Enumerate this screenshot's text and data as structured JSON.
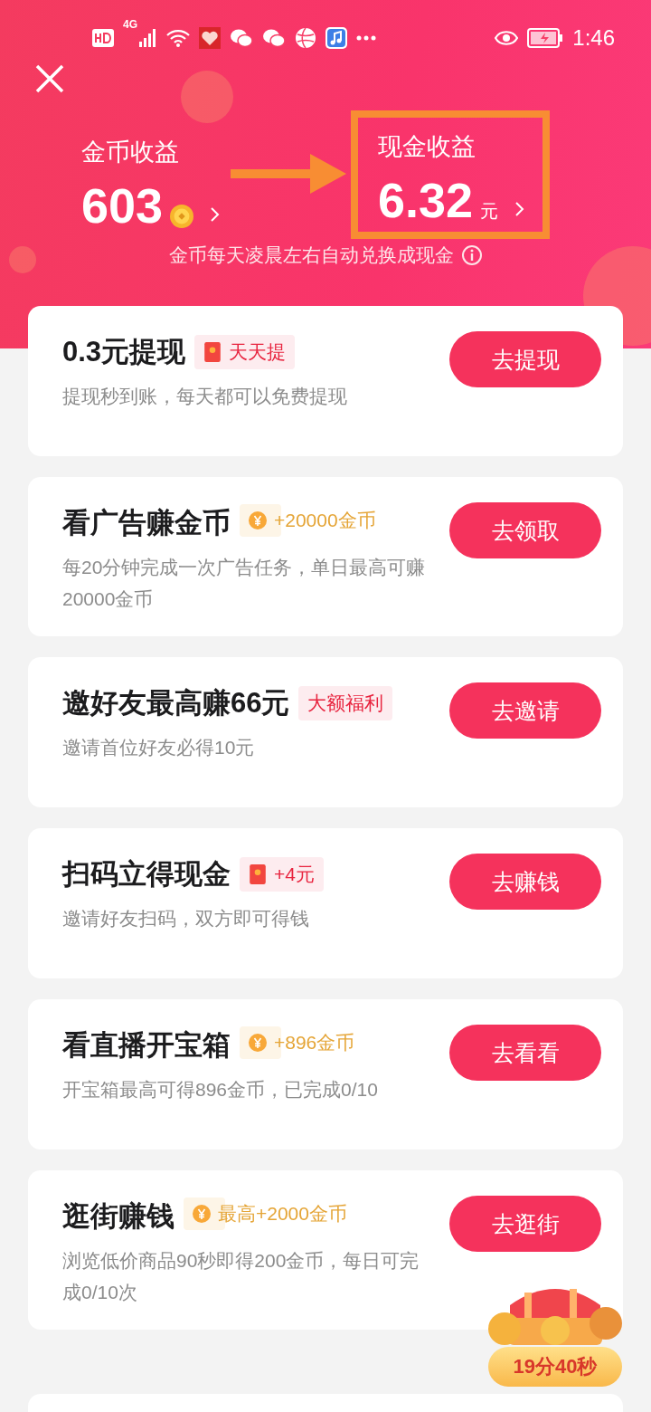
{
  "status_bar": {
    "network": "4G",
    "time": "1:46"
  },
  "earnings": [
    {
      "label": "金币收益",
      "amount": "603"
    },
    {
      "label": "现金收益",
      "amount": "6.32",
      "unit": "元",
      "highlighted": true
    }
  ],
  "exchange_note": "金币每天凌晨左右自动兑换成现金",
  "tasks": [
    {
      "title": "0.3元提现",
      "tag": {
        "kind": "redpacket",
        "text": "天天提"
      },
      "description": "提现秒到账，每天都可以免费提现",
      "button": "去提现"
    },
    {
      "title": "看广告赚金币",
      "tag": {
        "kind": "coin",
        "text": "+20000金币"
      },
      "description": "每20分钟完成一次广告任务，单日最高可赚20000金币",
      "button": "去领取"
    },
    {
      "title": "邀好友最高赚66元",
      "tag": {
        "kind": "plain",
        "text": "大额福利"
      },
      "description": "邀请首位好友必得10元",
      "button": "去邀请"
    },
    {
      "title": "扫码立得现金",
      "tag": {
        "kind": "redpacket",
        "text": "+4元"
      },
      "description": "邀请好友扫码，双方即可得钱",
      "button": "去赚钱"
    },
    {
      "title": "看直播开宝箱",
      "tag": {
        "kind": "coin",
        "text": "+896金币"
      },
      "description": "开宝箱最高可得896金币，已完成0/10",
      "button": "去看看"
    },
    {
      "title": "逛街赚钱",
      "tag": {
        "kind": "coin",
        "text": "最高+2000金币"
      },
      "description": "浏览低价商品90秒即得200金币，每日可完成0/10次",
      "button": "去逛街"
    }
  ],
  "treasure_timer": "19分40秒"
}
